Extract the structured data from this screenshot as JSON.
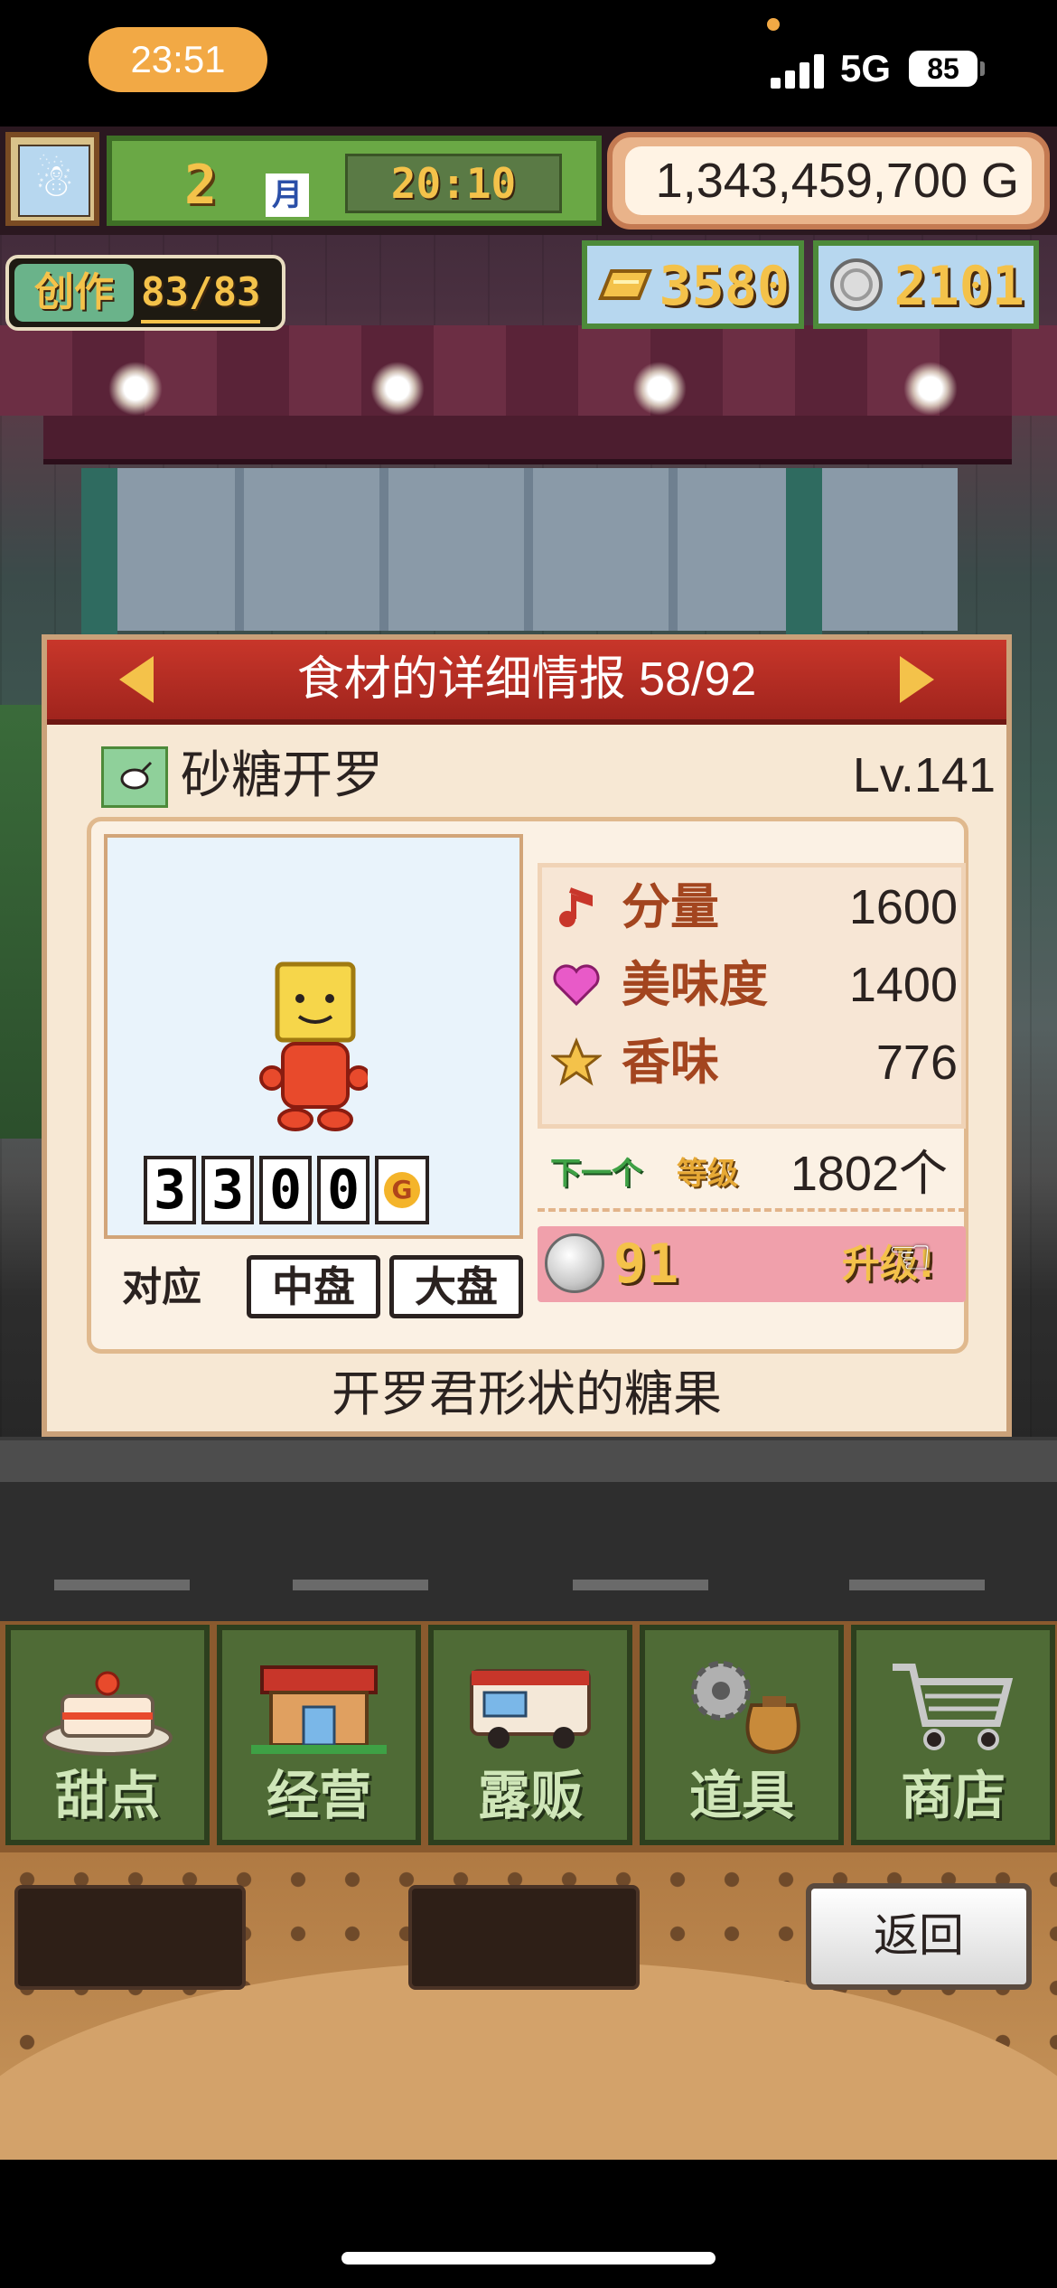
{
  "status_bar": {
    "time": "23:51",
    "network": "5G",
    "battery": "85"
  },
  "hud": {
    "month": "2",
    "month_label": "月",
    "clock": "20:10",
    "money": "1,343,459,700 G",
    "create_label": "创作",
    "create_count": "83/83",
    "gold_bars": "3580",
    "silver_coins": "2101"
  },
  "dialog": {
    "title": "食材的详细情报 58/92",
    "item_name": "砂糖开罗",
    "item_level": "Lv.141",
    "price_digits": [
      "3",
      "3",
      "0",
      "0"
    ],
    "price_currency": "G",
    "support_label": "对应",
    "plates": [
      "中盘",
      "大盘"
    ],
    "stats": [
      {
        "icon": "music-note-icon",
        "label": "分量",
        "value": "1600"
      },
      {
        "icon": "heart-icon",
        "label": "美味度",
        "value": "1400"
      },
      {
        "icon": "star-icon",
        "label": "香味",
        "value": "776"
      }
    ],
    "next_tag": "下一个",
    "next_tag2": "等级",
    "next_value": "1802个",
    "upgrade_cost": "91",
    "upgrade_label": "升级!",
    "description": "开罗君形状的糖果"
  },
  "nav": {
    "items": [
      {
        "label": "甜点",
        "icon": "cake-icon"
      },
      {
        "label": "经营",
        "icon": "shop-building-icon"
      },
      {
        "label": "露贩",
        "icon": "food-truck-icon"
      },
      {
        "label": "道具",
        "icon": "gear-bag-icon"
      },
      {
        "label": "商店",
        "icon": "shopping-cart-icon"
      }
    ]
  },
  "bottom": {
    "back_label": "返回"
  },
  "colors": {
    "header_red": "#c8362a",
    "gold_text": "#f4c24a",
    "panel_cream": "#f7e8d4",
    "nav_green": "#4f6b36"
  }
}
